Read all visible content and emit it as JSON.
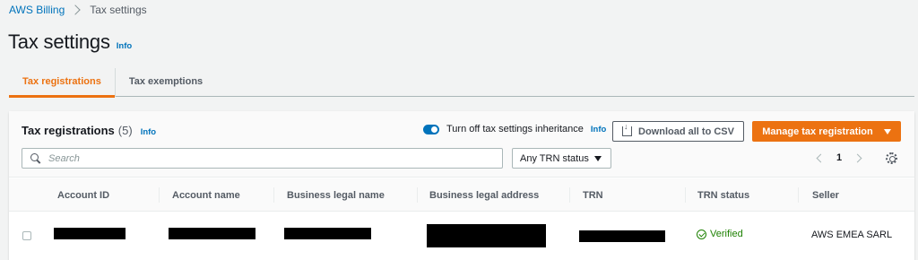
{
  "breadcrumb": {
    "root": "AWS Billing",
    "current": "Tax settings"
  },
  "page": {
    "title": "Tax settings",
    "info": "Info"
  },
  "tabs": [
    {
      "label": "Tax registrations",
      "active": true
    },
    {
      "label": "Tax exemptions",
      "active": false
    }
  ],
  "panel": {
    "title": "Tax registrations",
    "count": "(5)",
    "info": "Info",
    "toggle_label": "Turn off tax settings inheritance",
    "toggle_info": "Info",
    "toggle_on": true,
    "download_button": "Download all to CSV",
    "manage_button": "Manage tax registration"
  },
  "search": {
    "placeholder": "Search"
  },
  "filter": {
    "selected": "Any TRN status"
  },
  "pagination": {
    "current_page": "1"
  },
  "table": {
    "columns": [
      "Account ID",
      "Account name",
      "Business legal name",
      "Business legal address",
      "TRN",
      "TRN status",
      "Seller"
    ],
    "rows": [
      {
        "trn_status": "Verified",
        "seller": "AWS EMEA SARL"
      }
    ]
  },
  "colors": {
    "accent": "#ec7211",
    "link": "#0073bb",
    "success": "#1d8102"
  },
  "icons": [
    "chevron-right-icon",
    "toggle-icon",
    "download-icon",
    "caret-down-icon",
    "search-icon",
    "chevron-left-icon",
    "gear-icon",
    "check-circle-icon"
  ]
}
